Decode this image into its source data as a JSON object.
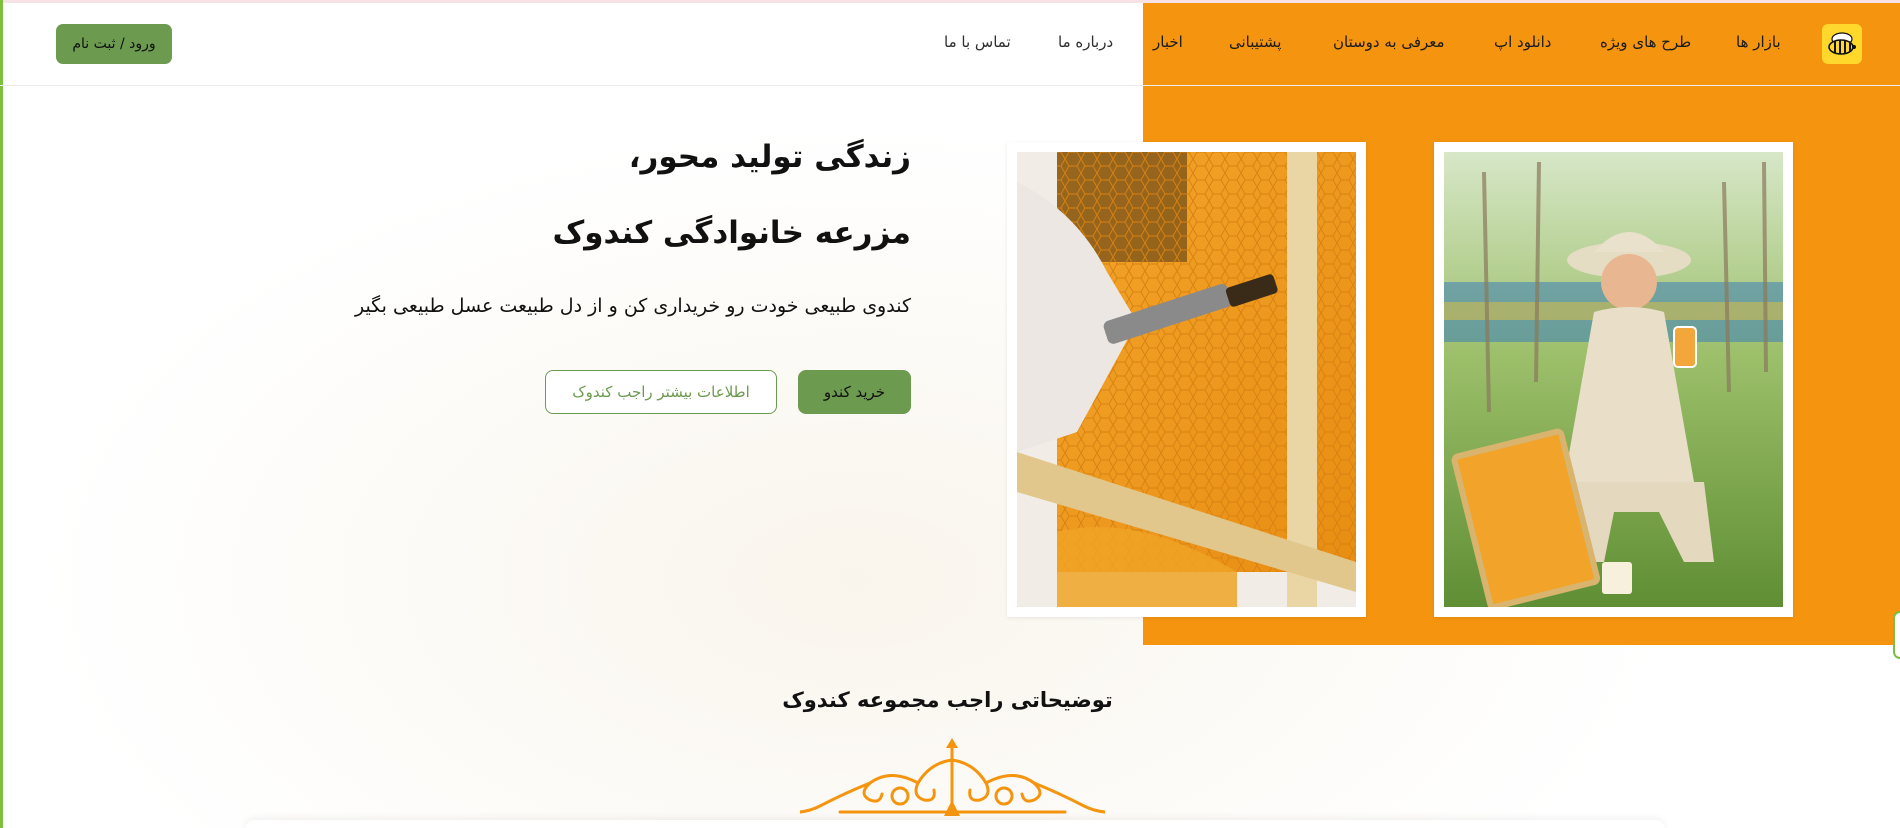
{
  "header": {
    "logo_icon": "bee-logo-icon",
    "nav": [
      "بازار ها",
      "طرح های ویژه",
      "دانلود اپ",
      "معرفی به دوستان",
      "پشتیبانی",
      "اخبار",
      "درباره ما",
      "تماس با ما"
    ],
    "login_label": "ورود / ثبت نام"
  },
  "hero": {
    "title_line1": "زندگی تولید محور،",
    "title_line2": "مزرعه خانوادگی کندوک",
    "subtitle": "کندوی طبیعی خودت رو خریداری کن و از دل طبیعت عسل طبیعی بگیر",
    "primary_button": "خرید کندو",
    "secondary_button": "اطلاعات بیشتر راجب کندوک"
  },
  "section": {
    "title": "توضیحاتی راجب مجموعه کندوک"
  },
  "colors": {
    "brand_orange": "#f4940f",
    "brand_green": "#6c9a4f",
    "logo_yellow": "#ffd82b"
  }
}
